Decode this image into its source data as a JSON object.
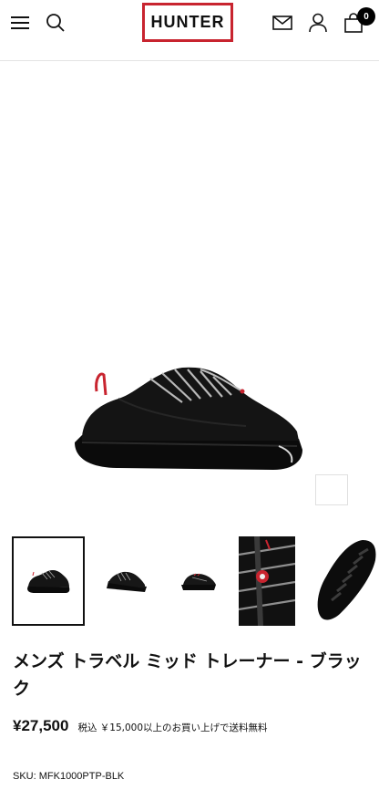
{
  "header": {
    "menu_icon": "hamburger-menu-icon",
    "search_icon": "search-icon",
    "logo_text": "HUNTER",
    "logo_accent": "#c8242f",
    "mail_icon": "envelope-icon",
    "account_icon": "user-icon",
    "cart_icon": "shopping-bag-icon",
    "cart_count": "0"
  },
  "gallery": {
    "zoom_icon": "zoom-search-icon",
    "thumbnails_count": 5,
    "active_index": 0
  },
  "product": {
    "title": "メンズ トラベル ミッド トレーナー - ブラック",
    "price": "¥27,500",
    "tax_note": "税込 ￥15,000以上のお買い上げで送料無料",
    "sku": "SKU: MFK1000PTP-BLK"
  }
}
